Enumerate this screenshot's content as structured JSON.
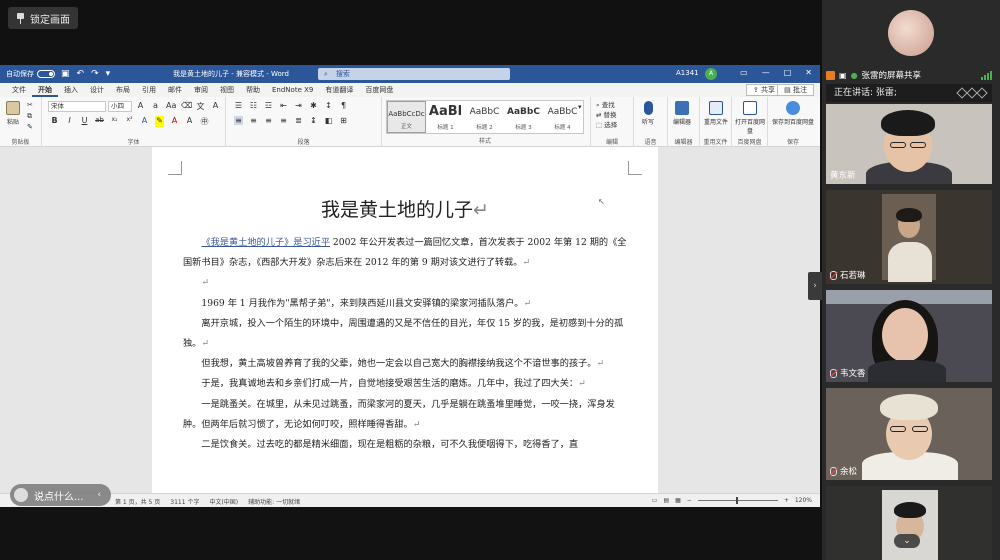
{
  "meeting": {
    "lock_label": "锁定画面",
    "chat_label": "说点什么...",
    "presenter_share": "张雷的屏幕共享",
    "speaking": "正在讲话: 张雷;",
    "collapse_glyph": "›",
    "expand_glyph": "⌄"
  },
  "participants": [
    {
      "name": "黄东新",
      "muted": false
    },
    {
      "name": "石若琳",
      "muted": true
    },
    {
      "name": "韦文香",
      "muted": true
    },
    {
      "name": "余松",
      "muted": true
    }
  ],
  "word": {
    "autosave": "自动保存",
    "doc_title": "我是黄土地的儿子 - 兼容模式 - Word",
    "search_placeholder": "搜索",
    "user": "A1341",
    "user_initial": "A",
    "tabs": [
      "文件",
      "开始",
      "插入",
      "设计",
      "布局",
      "引用",
      "邮件",
      "审阅",
      "视图",
      "帮助",
      "EndNote X9",
      "有道翻译",
      "百度网盘"
    ],
    "active_tab": "开始",
    "share_label": "共享",
    "comment_label": "批注",
    "ribbon": {
      "paste": "粘贴",
      "clipboard": "剪贴板",
      "font_name": "宋体",
      "font_size": "小四",
      "font_group": "字体",
      "paragraph_group": "段落",
      "styles_group": "样式",
      "editing_group": "编辑",
      "find": "查找",
      "replace": "替换",
      "select": "选择",
      "dictate": "听写",
      "voice_group": "语音",
      "editor": "编辑器",
      "editor_group": "编辑器",
      "reuse": "重用文件",
      "reuse_group": "重用文件",
      "open_baidu": "打开百度网盘",
      "baidu_group": "百度网盘",
      "save_baidu": "保存到百度网盘",
      "save_group": "保存",
      "styles": [
        {
          "sample": "AaBbCcDc",
          "name": "正文",
          "selected": true
        },
        {
          "sample": "AaBl",
          "name": "标题 1",
          "big": true
        },
        {
          "sample": "AaBbC",
          "name": "标题 2"
        },
        {
          "sample": "AaBbC",
          "name": "标题 3"
        },
        {
          "sample": "AaBbC",
          "name": "标题 4"
        }
      ]
    },
    "document": {
      "title": "我是黄土地的儿子",
      "p1_link": "《我是黄土地的儿子》是习近平",
      "p1_rest": " 2002 年公开发表过一篇回忆文章，首次发表于 2002 年第 12 期的《全国新书目》杂志，《西部大开发》杂志后来在 2012 年的第 9 期对该文进行了转载。",
      "p2": "1969 年 1 月我作为\"黑帮子弟\"，来到陕西延川县文安驿镇的梁家河插队落户。",
      "p3": "离开京城，投入一个陌生的环境中，周围遭遇的又是不信任的目光，年仅 15 岁的我，是初感到十分的孤独。",
      "p4": "但我想，黄土高坡曾养育了我的父辈，她也一定会以自己宽大的胸襟接纳我这个不谙世事的孩子。",
      "p5": "于是，我真诚地去和乡亲们打成一片，自觉地接受艰苦生活的磨炼。几年中，我过了四大关：",
      "p6": "一是跳蚤关。在城里，从未见过跳蚤，而梁家河的夏天，几乎是躺在跳蚤堆里睡觉，一咬一挠，浑身发肿。但两年后就习惯了，无论如何叮咬，照样睡得香甜。",
      "p7": "二是饮食关。过去吃的都是精米细面，现在是粗粝的杂粮，可不久我便咽得下，吃得香了，直",
      "para_mark": "↵"
    },
    "status": {
      "page": "第 1 页，共 5 页",
      "words": "3111 个字",
      "lang": "中文(中国)",
      "accessibility": "辅助功能: 一切就绪",
      "zoom": "120%"
    }
  },
  "colors": {
    "word_blue": "#2b579a",
    "presenter_badge": "#e67e22",
    "signal_green": "#4caf50"
  }
}
